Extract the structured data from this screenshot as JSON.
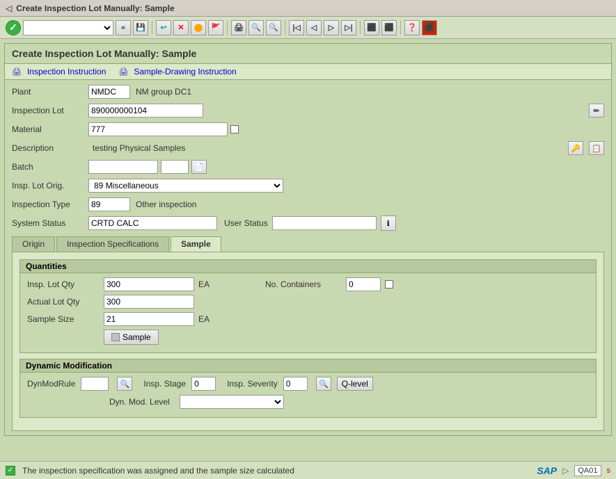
{
  "titleBar": {
    "icon": "◁",
    "title": "Create Inspection Lot Manually: Sample"
  },
  "toolbar": {
    "dropdownValue": "",
    "navBack": "«",
    "buttons": [
      "💾",
      "↩",
      "🔴",
      "🟠",
      "🔴",
      "🖨",
      "👤",
      "👤",
      "⬛",
      "⬛",
      "⬛",
      "⬛",
      "⬛",
      "⬛",
      "⬛",
      "🖥",
      "⬛",
      "❓",
      "🖥"
    ]
  },
  "formHeader": {
    "title": "Create Inspection Lot Manually: Sample"
  },
  "formToolbar": {
    "inspectionInstruction": "Inspection Instruction",
    "sampleDrawingInstruction": "Sample-Drawing Instruction"
  },
  "fields": {
    "plant": {
      "label": "Plant",
      "value": "NMDC",
      "extra": "NM group DC1"
    },
    "inspectionLot": {
      "label": "Inspection Lot",
      "value": "890000000104"
    },
    "material": {
      "label": "Material",
      "value": "777"
    },
    "description": {
      "label": "Description",
      "value": "testing Physical Samples"
    },
    "batch": {
      "label": "Batch",
      "value": "",
      "value2": ""
    },
    "inspLotOrig": {
      "label": "Insp. Lot Orig.",
      "value": "89 Miscellaneous"
    },
    "inspectionType": {
      "label": "Inspection Type",
      "value": "89",
      "extra": "Other inspection"
    },
    "systemStatus": {
      "label": "System Status",
      "value": "CRTD CALC",
      "userStatusLabel": "User Status",
      "userStatusValue": ""
    }
  },
  "tabs": {
    "origin": "Origin",
    "inspectionSpecifications": "Inspection Specifications",
    "sample": "Sample",
    "activeTab": "Sample"
  },
  "quantities": {
    "sectionTitle": "Quantities",
    "inspLotQty": {
      "label": "Insp. Lot Qty",
      "value": "300",
      "unit": "EA"
    },
    "actualLotQty": {
      "label": "Actual Lot Qty",
      "value": "300"
    },
    "sampleSize": {
      "label": "Sample Size",
      "value": "21",
      "unit": "EA"
    },
    "sampleButton": "Sample",
    "noContainers": {
      "label": "No. Containers",
      "value": "0",
      "extra": ""
    }
  },
  "dynamicModification": {
    "sectionTitle": "Dynamic Modification",
    "dynModRule": {
      "label": "DynModRule",
      "value": ""
    },
    "inspStage": {
      "label": "Insp. Stage",
      "value": "0"
    },
    "inspSeverity": {
      "label": "Insp. Severity",
      "value": "0"
    },
    "qLevel": "Q-level",
    "dynModLevel": {
      "label": "Dyn. Mod. Level",
      "value": ""
    }
  },
  "statusBar": {
    "message": "The inspection specification was assigned and the sample size calculated",
    "system": "QA01",
    "navArrow": "▷"
  }
}
